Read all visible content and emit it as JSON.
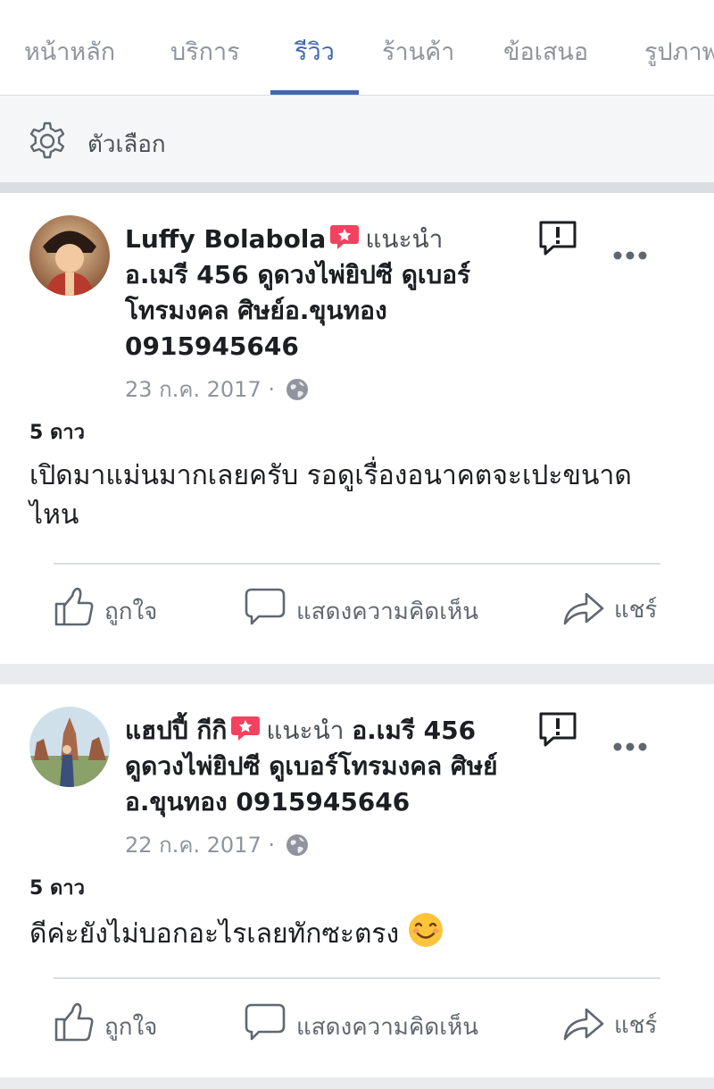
{
  "tabs": [
    {
      "label": "หน้าหลัก"
    },
    {
      "label": "บริการ"
    },
    {
      "label": "รีวิว"
    },
    {
      "label": "ร้านค้า"
    },
    {
      "label": "ข้อเสนอ"
    },
    {
      "label": "รูปภาพ"
    }
  ],
  "active_tab": "รีวิว",
  "options": {
    "label": "ตัวเลือก",
    "icon": "gear-icon"
  },
  "colors": {
    "accent": "#4267b2",
    "badge": "#f3425f",
    "secondary": "#90949c"
  },
  "reviews": [
    {
      "name": "Luffy Bolabola",
      "recommends": "แนะนำ",
      "page": "อ.เมรี 456 ดูดวงไพ่ยิปซี ดูเบอร์โทรมงคล ศิษย์อ.ขุนทอง 0915945646",
      "date": "23 ก.ค. 2017",
      "separator": "·",
      "rating": "5 ดาว",
      "text": "เปิดมาแม่นมากเลยครับ รอดูเรื่องอนาคตจะเปะขนาดไหน"
    },
    {
      "name": "แฮปปี้ กีกิ",
      "recommends": "แนะนำ",
      "page": "อ.เมรี 456 ดูดวงไพ่ยิปซี ดูเบอร์โทรมงคล ศิษย์อ.ขุนทอง 0915945646",
      "date": "22 ก.ค. 2017",
      "separator": "·",
      "rating": "5 ดาว",
      "text": "ดีค่ะยังไม่บอกอะไรเลยทักซะตรง"
    }
  ],
  "actions": {
    "like": "ถูกใจ",
    "comment": "แสดงความคิดเห็น",
    "share": "แชร์"
  }
}
